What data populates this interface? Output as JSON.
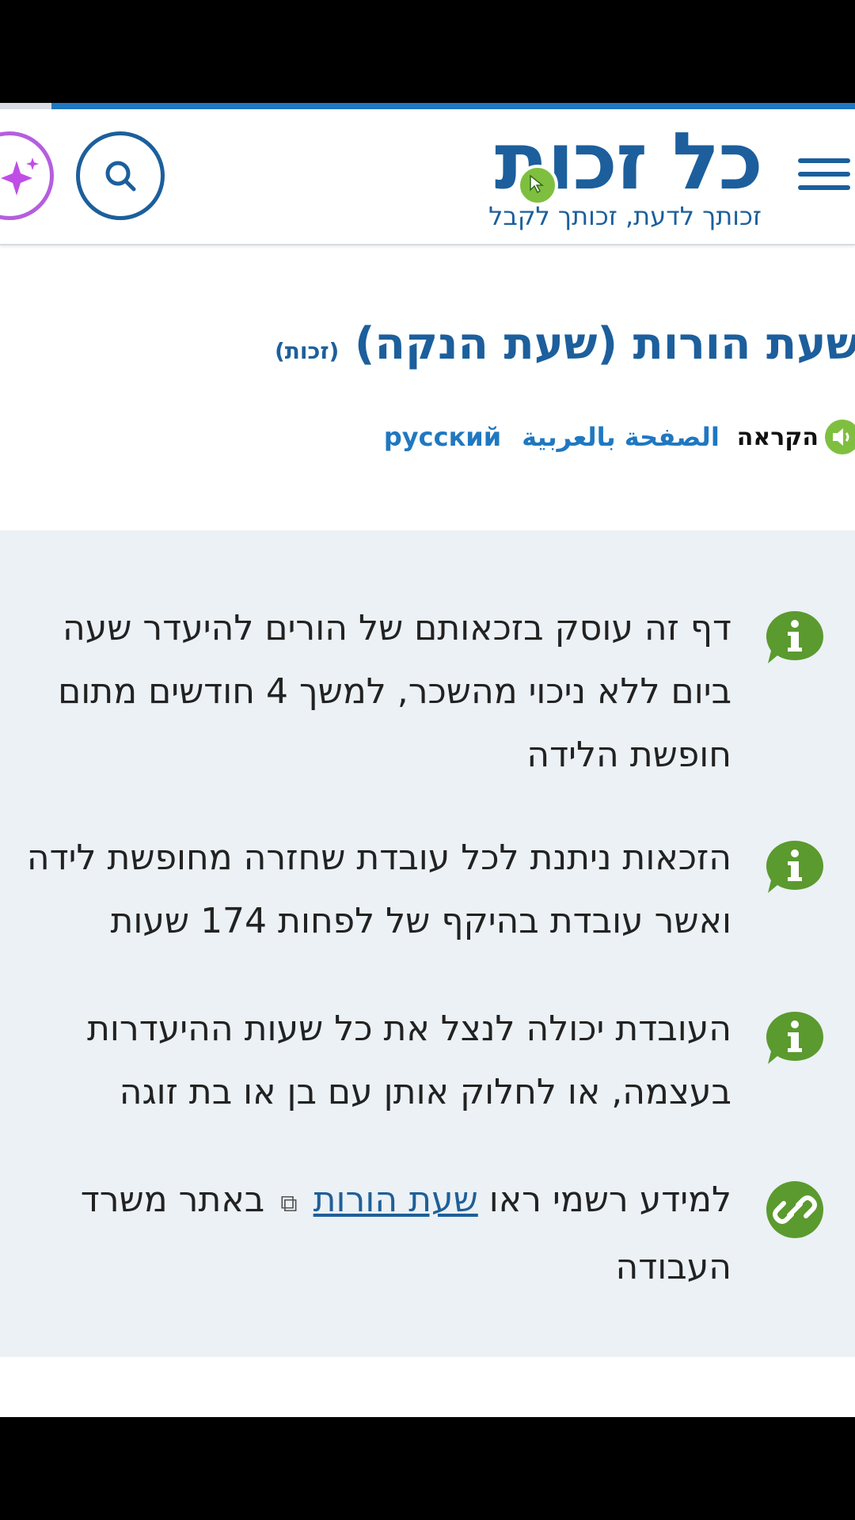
{
  "header": {
    "logo_title": "כל זכות",
    "logo_tagline": "זכותך לדעת, זכותך לקבל",
    "menu_icon": "hamburger-icon",
    "search_icon": "search-icon",
    "ai_icon": "sparkle-icon",
    "brand_color": "#1c5f9c",
    "accent_green": "#7fbf3f",
    "ai_color": "#b45ee0",
    "reading_progress": 0.94
  },
  "article": {
    "title": "שעת הורות (שעת הנקה)",
    "title_tag": "(זכות)",
    "read_aloud_label": "הקראה",
    "lang_arabic": "الصفحة بالعربية",
    "lang_russian": "русский"
  },
  "info_items": [
    {
      "icon": "info-icon",
      "text": "דף זה עוסק בזכאותם של הורים להיעדר שעה ביום ללא ניכוי מהשכר, למשך 4 חודשים מתום חופשת הלידה"
    },
    {
      "icon": "info-icon",
      "text": "הזכאות ניתנת לכל עובדת שחזרה מחופשת לידה ואשר עובדת בהיקף של לפחות 174 שעות"
    },
    {
      "icon": "info-icon",
      "text": "העובדת יכולה לנצל את כל שעות ההיעדרות בעצמה, או לחלוק אותן עם בן או בת זוגה"
    },
    {
      "icon": "link-icon",
      "text_before": "למידע רשמי ראו",
      "link_text": "שעת הורות",
      "text_after": "באתר משרד העבודה",
      "ext_icon": "external-link-icon"
    }
  ]
}
